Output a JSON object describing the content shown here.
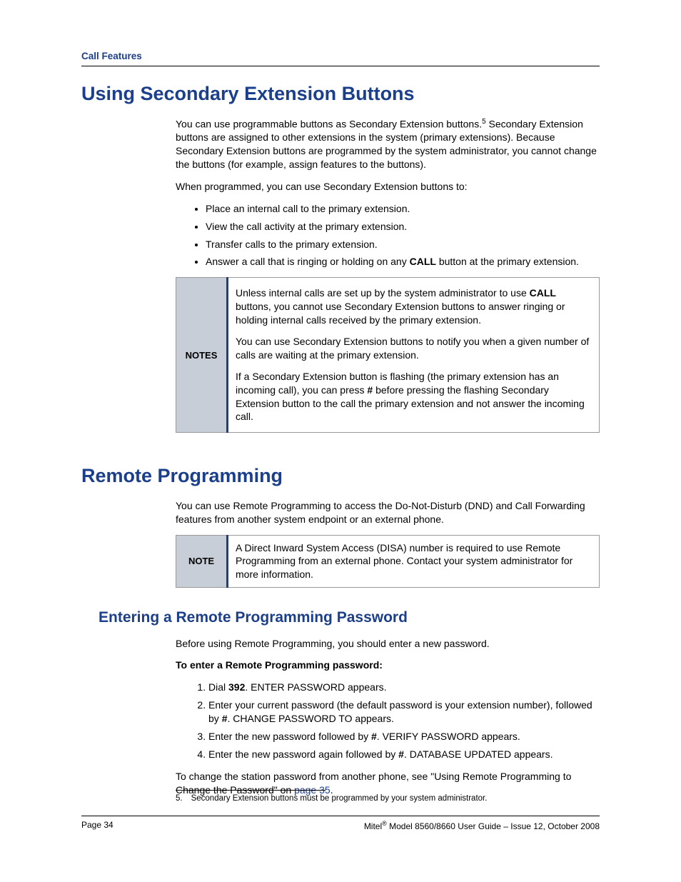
{
  "header": {
    "section": "Call Features"
  },
  "section1": {
    "title": "Using Secondary Extension Buttons",
    "p1a": "You can use programmable buttons as Secondary Extension buttons.",
    "p1_sup": "5",
    "p1b": " Secondary Extension buttons are assigned to other extensions in the system (primary extensions). Because Secondary Extension buttons are programmed by the system administrator, you cannot change the buttons (for example, assign features to the buttons).",
    "p2": "When programmed, you can use Secondary Extension buttons to:",
    "bullets": {
      "b1": "Place an internal call to the primary extension.",
      "b2": "View the call activity at the primary extension.",
      "b3": "Transfer calls to the primary extension.",
      "b4a": "Answer a call that is ringing or holding on any ",
      "b4_bold": "CALL",
      "b4b": " button at the primary extension."
    },
    "notes_label": "NOTES",
    "notes": {
      "n1a": "Unless internal calls are set up by the system administrator to use ",
      "n1_bold": "CALL",
      "n1b": " buttons, you cannot use Secondary Extension buttons to answer ringing or holding internal calls received by the primary extension.",
      "n2": "You can use Secondary Extension buttons to notify you when a given number of calls are waiting at the primary extension.",
      "n3a": "If a Secondary Extension button is flashing (the primary extension has an incoming call), you can press ",
      "n3_bold": "#",
      "n3b": " before pressing the flashing Secondary Extension button to the call the primary extension and not answer the incoming call."
    }
  },
  "section2": {
    "title": "Remote Programming",
    "p1": "You can use Remote Programming to access the Do-Not-Disturb (DND) and Call Forwarding features from another system endpoint or an external phone.",
    "note_label": "NOTE",
    "note": "A Direct Inward System Access (DISA) number is required to use Remote Programming from an external phone. Contact your system administrator for more information."
  },
  "section3": {
    "title": "Entering a Remote Programming Password",
    "p1": "Before using Remote Programming, you should enter a new password.",
    "lead": "To enter a Remote Programming password:",
    "steps": {
      "s1a": "Dial ",
      "s1_bold": "392",
      "s1b": ". ENTER PASSWORD appears.",
      "s2a": "Enter your current password (the default password is your extension number), followed by ",
      "s2_bold": "#",
      "s2b": ". CHANGE PASSWORD TO appears.",
      "s3a": "Enter the new password followed by ",
      "s3_bold": "#",
      "s3b": ". VERIFY PASSWORD appears.",
      "s4a": "Enter the new password again followed by ",
      "s4_bold": "#",
      "s4b": ". DATABASE UPDATED appears."
    },
    "p2a": "To change the station password from another phone, see \"Using Remote Programming to Change the Password\" on ",
    "p2_link": "page 35",
    "p2b": "."
  },
  "footnote": {
    "num": "5.",
    "text": "Secondary Extension buttons must be programmed by your system administrator."
  },
  "footer": {
    "left": "Page 34",
    "right_a": "Mitel",
    "right_reg": "®",
    "right_b": " Model 8560/8660 User Guide – Issue 12, October 2008"
  }
}
